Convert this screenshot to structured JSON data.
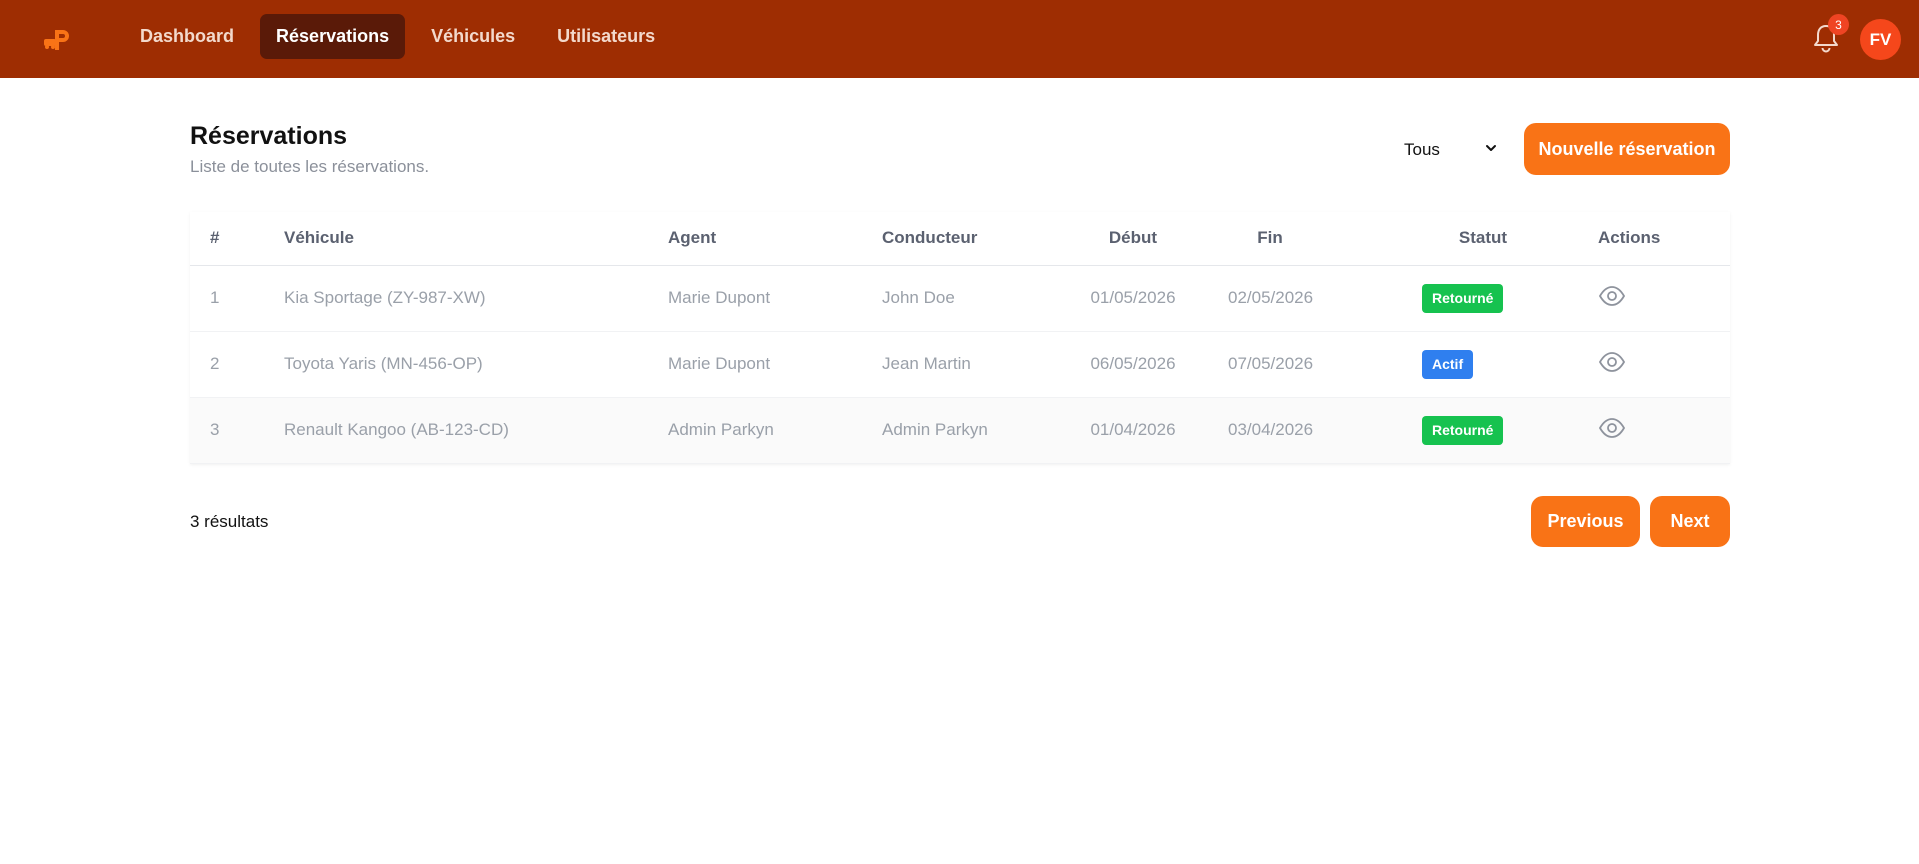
{
  "nav": {
    "brand_icon": "parking-car-logo-icon",
    "items": [
      {
        "label": "Dashboard",
        "active": false
      },
      {
        "label": "Réservations",
        "active": true
      },
      {
        "label": "Véhicules",
        "active": false
      },
      {
        "label": "Utilisateurs",
        "active": false
      }
    ],
    "notifications_count": "3",
    "avatar_initials": "FV"
  },
  "header": {
    "title": "Réservations",
    "subtitle": "Liste de toutes les réservations.",
    "filter_value": "Tous",
    "new_button": "Nouvelle réservation"
  },
  "table": {
    "columns": [
      "#",
      "Véhicule",
      "Agent",
      "Conducteur",
      "Début",
      "Fin",
      "Statut",
      "Actions"
    ],
    "rows": [
      {
        "id": "1",
        "vehicle": "Kia Sportage (ZY-987-XW)",
        "agent": "Marie Dupont",
        "driver": "John Doe",
        "start": "01/05/2026",
        "end": "02/05/2026",
        "status": "Retourné",
        "status_color": "#16c24f"
      },
      {
        "id": "2",
        "vehicle": "Toyota Yaris (MN-456-OP)",
        "agent": "Marie Dupont",
        "driver": "Jean Martin",
        "start": "06/05/2026",
        "end": "07/05/2026",
        "status": "Actif",
        "status_color": "#2f7fef"
      },
      {
        "id": "3",
        "vehicle": "Renault Kangoo (AB-123-CD)",
        "agent": "Admin Parkyn",
        "driver": "Admin Parkyn",
        "start": "01/04/2026",
        "end": "03/04/2026",
        "status": "Retourné",
        "status_color": "#16c24f"
      }
    ]
  },
  "footer": {
    "result_count": "3 résultats",
    "previous_label": "Previous",
    "next_label": "Next"
  },
  "colors": {
    "topbar": "#9e2d02",
    "accent": "#f97316",
    "nav_active": "#5a1a08",
    "avatar": "#f5471b"
  }
}
